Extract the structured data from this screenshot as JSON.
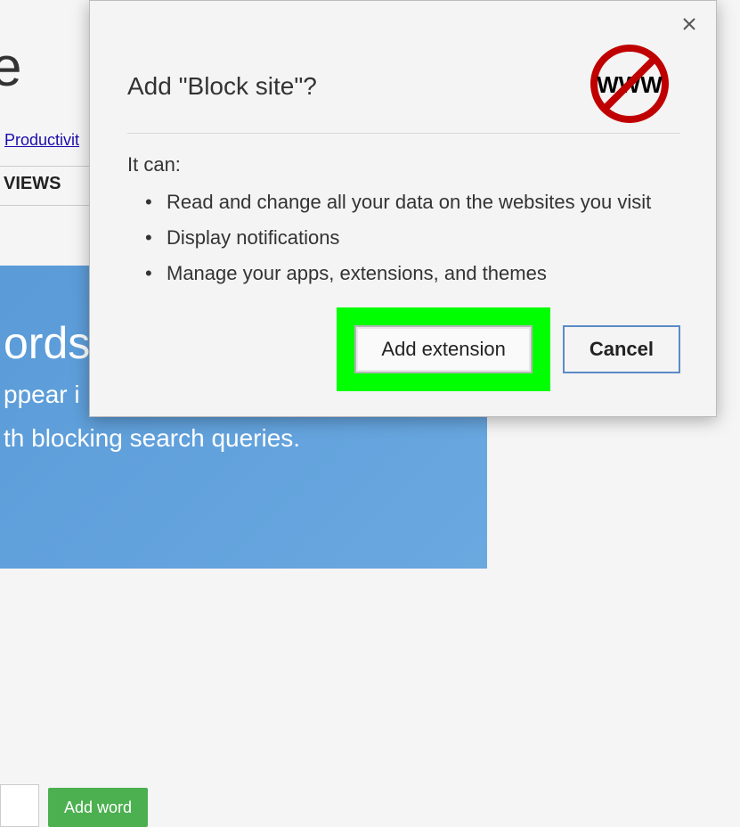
{
  "background": {
    "title_fragment": "e",
    "productivity_link": "Productivit",
    "tabs_text": "VIEWS",
    "promo_title": "ords",
    "promo_line1": "ppear i",
    "promo_line2": "th blocking search queries.",
    "add_word_button": "Add word"
  },
  "dialog": {
    "title": "Add \"Block site\"?",
    "icon_text": "WWW",
    "subtitle": "It can:",
    "permissions": [
      "Read and change all your data on the websites you visit",
      "Display notifications",
      "Manage your apps, extensions, and themes"
    ],
    "add_button": "Add extension",
    "cancel_button": "Cancel"
  }
}
